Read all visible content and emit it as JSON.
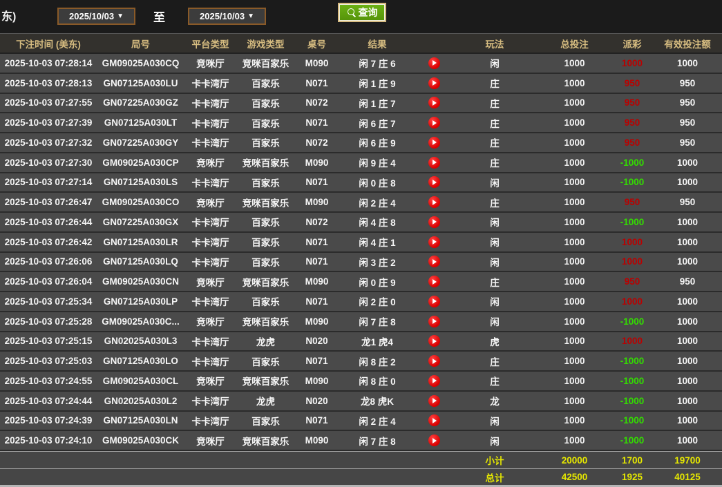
{
  "topbar": {
    "partial_label": "东)",
    "date_from": "2025/10/03",
    "to_label": "至",
    "date_to": "2025/10/03",
    "dropdown_arrow": "▼",
    "query_label": "查询"
  },
  "table": {
    "headers": {
      "bet_time": "下注时间 (美东)",
      "round_id": "局号",
      "platform": "平台类型",
      "game_type": "游戏类型",
      "table_no": "桌号",
      "result": "结果",
      "video": "",
      "bet_type": "玩法",
      "total_bet": "总投注",
      "payout": "派彩",
      "valid_bet": "有效投注额"
    },
    "rows": [
      {
        "time": "2025-10-03 07:28:14",
        "round": "GM09025A030CQ",
        "platform": "竞咪厅",
        "game": "竞咪百家乐",
        "table_no": "M090",
        "result": "闲 7 庄 6",
        "bet": "闲",
        "total": "1000",
        "payout": "1000",
        "payout_class": "red",
        "valid": "1000"
      },
      {
        "time": "2025-10-03 07:28:13",
        "round": "GN07125A030LU",
        "platform": "卡卡湾厅",
        "game": "百家乐",
        "table_no": "N071",
        "result": "闲 1 庄 9",
        "bet": "庄",
        "total": "1000",
        "payout": "950",
        "payout_class": "red",
        "valid": "950"
      },
      {
        "time": "2025-10-03 07:27:55",
        "round": "GN07225A030GZ",
        "platform": "卡卡湾厅",
        "game": "百家乐",
        "table_no": "N072",
        "result": "闲 1 庄 7",
        "bet": "庄",
        "total": "1000",
        "payout": "950",
        "payout_class": "red",
        "valid": "950"
      },
      {
        "time": "2025-10-03 07:27:39",
        "round": "GN07125A030LT",
        "platform": "卡卡湾厅",
        "game": "百家乐",
        "table_no": "N071",
        "result": "闲 6 庄 7",
        "bet": "庄",
        "total": "1000",
        "payout": "950",
        "payout_class": "red",
        "valid": "950"
      },
      {
        "time": "2025-10-03 07:27:32",
        "round": "GN07225A030GY",
        "platform": "卡卡湾厅",
        "game": "百家乐",
        "table_no": "N072",
        "result": "闲 6 庄 9",
        "bet": "庄",
        "total": "1000",
        "payout": "950",
        "payout_class": "red",
        "valid": "950"
      },
      {
        "time": "2025-10-03 07:27:30",
        "round": "GM09025A030CP",
        "platform": "竞咪厅",
        "game": "竞咪百家乐",
        "table_no": "M090",
        "result": "闲 9 庄 4",
        "bet": "庄",
        "total": "1000",
        "payout": "-1000",
        "payout_class": "green",
        "valid": "1000"
      },
      {
        "time": "2025-10-03 07:27:14",
        "round": "GN07125A030LS",
        "platform": "卡卡湾厅",
        "game": "百家乐",
        "table_no": "N071",
        "result": "闲 0 庄 8",
        "bet": "闲",
        "total": "1000",
        "payout": "-1000",
        "payout_class": "green",
        "valid": "1000"
      },
      {
        "time": "2025-10-03 07:26:47",
        "round": "GM09025A030CO",
        "platform": "竞咪厅",
        "game": "竞咪百家乐",
        "table_no": "M090",
        "result": "闲 2 庄 4",
        "bet": "庄",
        "total": "1000",
        "payout": "950",
        "payout_class": "red",
        "valid": "950"
      },
      {
        "time": "2025-10-03 07:26:44",
        "round": "GN07225A030GX",
        "platform": "卡卡湾厅",
        "game": "百家乐",
        "table_no": "N072",
        "result": "闲 4 庄 8",
        "bet": "闲",
        "total": "1000",
        "payout": "-1000",
        "payout_class": "green",
        "valid": "1000"
      },
      {
        "time": "2025-10-03 07:26:42",
        "round": "GN07125A030LR",
        "platform": "卡卡湾厅",
        "game": "百家乐",
        "table_no": "N071",
        "result": "闲 4 庄 1",
        "bet": "闲",
        "total": "1000",
        "payout": "1000",
        "payout_class": "red",
        "valid": "1000"
      },
      {
        "time": "2025-10-03 07:26:06",
        "round": "GN07125A030LQ",
        "platform": "卡卡湾厅",
        "game": "百家乐",
        "table_no": "N071",
        "result": "闲 3 庄 2",
        "bet": "闲",
        "total": "1000",
        "payout": "1000",
        "payout_class": "red",
        "valid": "1000"
      },
      {
        "time": "2025-10-03 07:26:04",
        "round": "GM09025A030CN",
        "platform": "竞咪厅",
        "game": "竞咪百家乐",
        "table_no": "M090",
        "result": "闲 0 庄 9",
        "bet": "庄",
        "total": "1000",
        "payout": "950",
        "payout_class": "red",
        "valid": "950"
      },
      {
        "time": "2025-10-03 07:25:34",
        "round": "GN07125A030LP",
        "platform": "卡卡湾厅",
        "game": "百家乐",
        "table_no": "N071",
        "result": "闲 2 庄 0",
        "bet": "闲",
        "total": "1000",
        "payout": "1000",
        "payout_class": "red",
        "valid": "1000"
      },
      {
        "time": "2025-10-03 07:25:28",
        "round": "GM09025A030C...",
        "platform": "竞咪厅",
        "game": "竞咪百家乐",
        "table_no": "M090",
        "result": "闲 7 庄 8",
        "bet": "闲",
        "total": "1000",
        "payout": "-1000",
        "payout_class": "green",
        "valid": "1000"
      },
      {
        "time": "2025-10-03 07:25:15",
        "round": "GN02025A030L3",
        "platform": "卡卡湾厅",
        "game": "龙虎",
        "table_no": "N020",
        "result": "龙1 虎4",
        "bet": "虎",
        "total": "1000",
        "payout": "1000",
        "payout_class": "red",
        "valid": "1000"
      },
      {
        "time": "2025-10-03 07:25:03",
        "round": "GN07125A030LO",
        "platform": "卡卡湾厅",
        "game": "百家乐",
        "table_no": "N071",
        "result": "闲 8 庄 2",
        "bet": "庄",
        "total": "1000",
        "payout": "-1000",
        "payout_class": "green",
        "valid": "1000"
      },
      {
        "time": "2025-10-03 07:24:55",
        "round": "GM09025A030CL",
        "platform": "竞咪厅",
        "game": "竞咪百家乐",
        "table_no": "M090",
        "result": "闲 8 庄 0",
        "bet": "庄",
        "total": "1000",
        "payout": "-1000",
        "payout_class": "green",
        "valid": "1000"
      },
      {
        "time": "2025-10-03 07:24:44",
        "round": "GN02025A030L2",
        "platform": "卡卡湾厅",
        "game": "龙虎",
        "table_no": "N020",
        "result": "龙8 虎K",
        "bet": "龙",
        "total": "1000",
        "payout": "-1000",
        "payout_class": "green",
        "valid": "1000"
      },
      {
        "time": "2025-10-03 07:24:39",
        "round": "GN07125A030LN",
        "platform": "卡卡湾厅",
        "game": "百家乐",
        "table_no": "N071",
        "result": "闲 2 庄 4",
        "bet": "闲",
        "total": "1000",
        "payout": "-1000",
        "payout_class": "green",
        "valid": "1000"
      },
      {
        "time": "2025-10-03 07:24:10",
        "round": "GM09025A030CK",
        "platform": "竞咪厅",
        "game": "竞咪百家乐",
        "table_no": "M090",
        "result": "闲 7 庄 8",
        "bet": "闲",
        "total": "1000",
        "payout": "-1000",
        "payout_class": "green",
        "valid": "1000"
      }
    ],
    "subtotal": {
      "label": "小计",
      "total": "20000",
      "payout": "1700",
      "valid": "19700"
    },
    "grand_total": {
      "label": "总计",
      "total": "42500",
      "payout": "1925",
      "valid": "40125"
    }
  },
  "colors": {
    "topbar_bg": "#1b1b1b",
    "header_bg": "#33312d",
    "header_text": "#d6bc80",
    "row_bg": "#4a4a4a",
    "payout_positive": "#bb0000",
    "payout_negative": "#33dd00",
    "footer_text": "#e6e800",
    "query_button_green": "#61a512",
    "date_border": "#8a5a28",
    "play_icon_red": "#e60000"
  }
}
